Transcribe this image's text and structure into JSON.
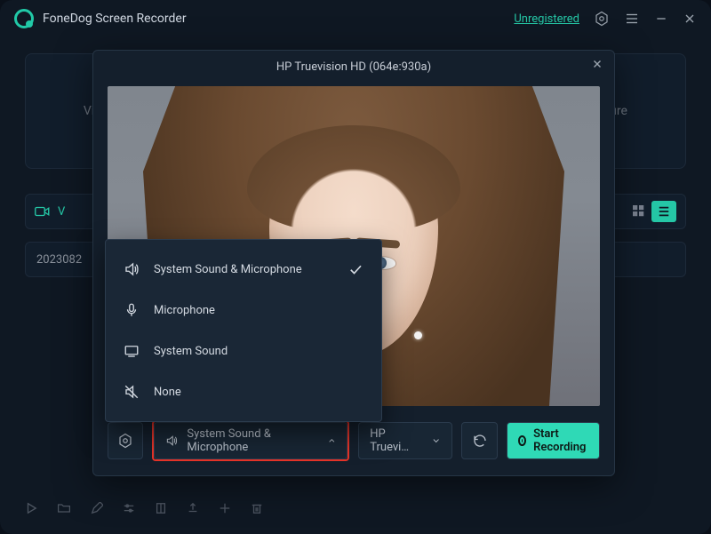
{
  "app": {
    "name": "FoneDog Screen Recorder"
  },
  "titlebar": {
    "unregistered": "Unregistered"
  },
  "back": {
    "leftCell": "Vid",
    "rightCell": "ure",
    "tabLabel": "V",
    "listItem": "2023082"
  },
  "overlay": {
    "title": "HP Truevision HD (064e:930a)",
    "toolbar": {
      "audioLabel": "System Sound & Microphone",
      "deviceLabel": "HP Truevi…",
      "startLabel": "Start Recording"
    }
  },
  "audioMenu": {
    "items": [
      {
        "label": "System Sound & Microphone",
        "selected": true,
        "icon": "speaker-icon"
      },
      {
        "label": "Microphone",
        "selected": false,
        "icon": "microphone-icon"
      },
      {
        "label": "System Sound",
        "selected": false,
        "icon": "system-sound-icon"
      },
      {
        "label": "None",
        "selected": false,
        "icon": "mute-icon"
      }
    ]
  }
}
